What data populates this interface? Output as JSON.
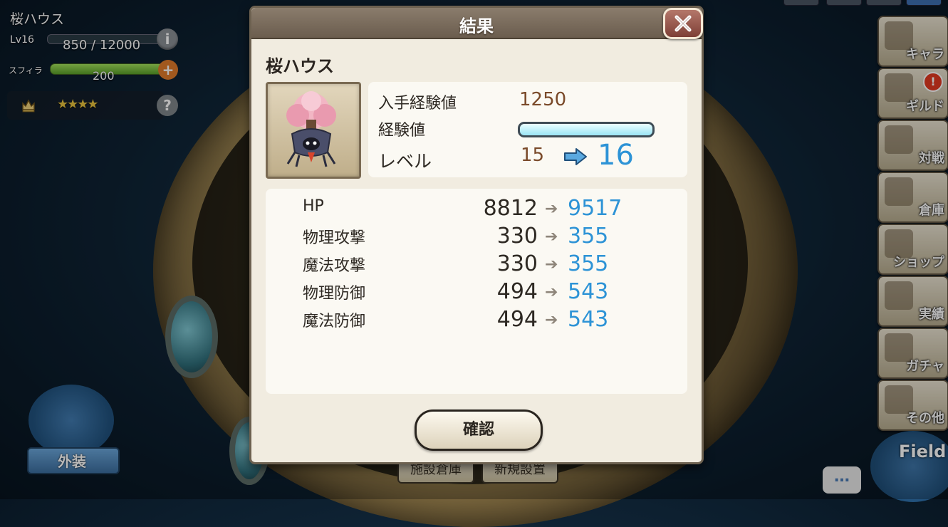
{
  "hud": {
    "facility_name": "桜ハウス",
    "level_label": "Lv16",
    "exp_text": "850 / 12000",
    "info_label": "i",
    "sfira_label": "スフィラ",
    "sfira_value": "200",
    "plus_label": "+",
    "stars": "★★★★",
    "help_label": "?"
  },
  "menu": [
    {
      "label": "キャラ"
    },
    {
      "label": "ギルド",
      "badge": "!"
    },
    {
      "label": "対戦"
    },
    {
      "label": "倉庫"
    },
    {
      "label": "ショップ"
    },
    {
      "label": "実績"
    },
    {
      "label": "ガチャ"
    },
    {
      "label": "その他"
    }
  ],
  "bottom": {
    "costume_label": "外装",
    "storage_btn": "施設倉庫",
    "new_build_btn": "新規設置",
    "chat_label": "…",
    "field_label": "Field"
  },
  "dialog": {
    "title": "結果",
    "item_name": "桜ハウス",
    "gain_label": "入手経験値",
    "gain_value": "1250",
    "exp_label": "経験値",
    "exp_fill": 1.0,
    "level_label": "レベル",
    "level_from": "15",
    "level_to": "16",
    "stat_arrow": "➔",
    "stats": [
      {
        "name": "HP",
        "old": "8812",
        "new": "9517"
      },
      {
        "name": "物理攻撃",
        "old": "330",
        "new": "355"
      },
      {
        "name": "魔法攻撃",
        "old": "330",
        "new": "355"
      },
      {
        "name": "物理防御",
        "old": "494",
        "new": "543"
      },
      {
        "name": "魔法防御",
        "old": "494",
        "new": "543"
      }
    ],
    "confirm_label": "確認"
  },
  "colors": {
    "accent_blue": "#2d93d6",
    "value_brown": "#7a4a2a",
    "header_brown": "#6b5d4e"
  }
}
